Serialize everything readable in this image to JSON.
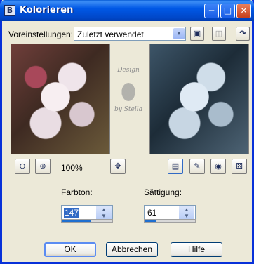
{
  "window": {
    "title": "Kolorieren",
    "app_icon": "B"
  },
  "presets": {
    "label": "Voreinstellungen:",
    "value": "Zuletzt verwendet"
  },
  "watermark": {
    "line1": "Design",
    "line2": "by Stella"
  },
  "zoom": {
    "value": "100%"
  },
  "hue": {
    "label": "Farbton:",
    "value": "147",
    "fraction": 0.58
  },
  "saturation": {
    "label": "Sättigung:",
    "value": "61",
    "fraction": 0.24
  },
  "buttons": {
    "ok": "OK",
    "cancel": "Abbrechen",
    "help": "Hilfe"
  },
  "colors": {
    "titlebar": "#0058e6",
    "accent": "#316ac5",
    "background": "#ece9d8"
  },
  "icons": {
    "save": "save-icon",
    "delete": "trash-icon",
    "reset": "reset-icon",
    "zoom_out": "zoom-out-icon",
    "zoom_in": "zoom-in-icon",
    "pan": "pan-icon",
    "preview": "preview-icon",
    "proof": "proof-icon",
    "eye": "eye-icon",
    "random": "dice-icon"
  }
}
